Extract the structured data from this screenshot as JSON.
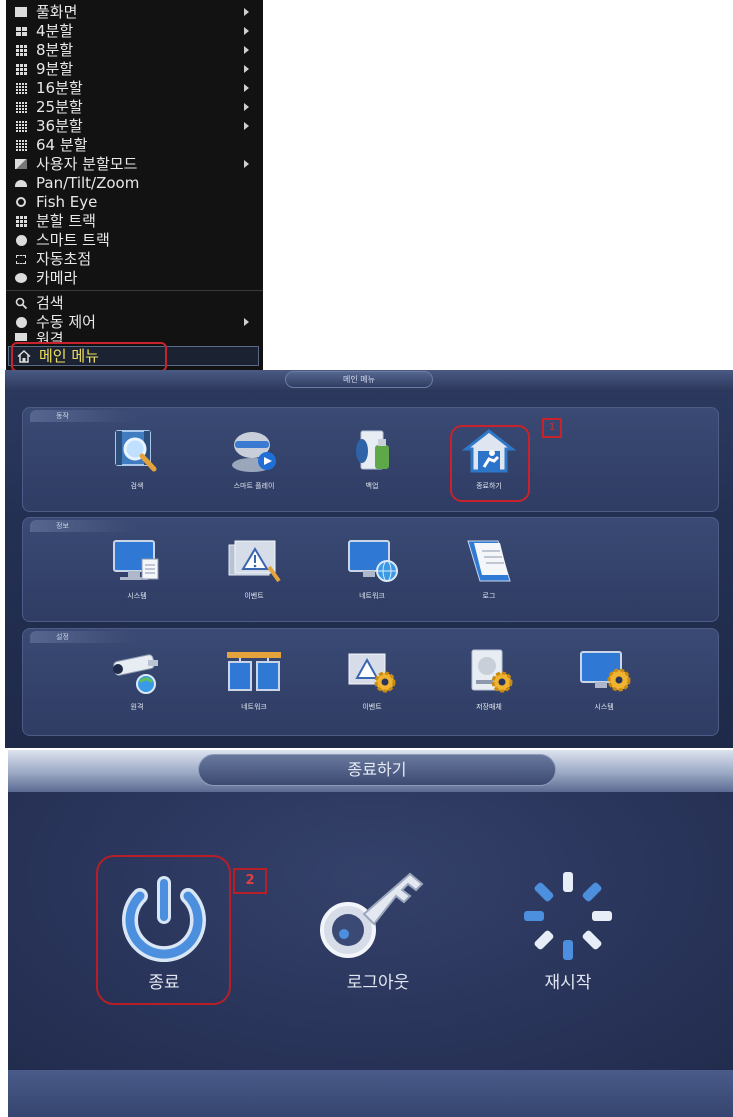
{
  "context_menu": {
    "items": [
      {
        "label": "풀화면",
        "icon": "square-icon",
        "has_submenu": true
      },
      {
        "label": "4분할",
        "icon": "grid-4-icon",
        "has_submenu": true
      },
      {
        "label": "8분할",
        "icon": "grid-8-icon",
        "has_submenu": true
      },
      {
        "label": "9분할",
        "icon": "grid-9-icon",
        "has_submenu": true
      },
      {
        "label": "16분할",
        "icon": "grid-16-icon",
        "has_submenu": true
      },
      {
        "label": "25분할",
        "icon": "grid-25-icon",
        "has_submenu": true
      },
      {
        "label": "36분할",
        "icon": "grid-36-icon",
        "has_submenu": true
      },
      {
        "label": "64 분할",
        "icon": "grid-64-icon",
        "has_submenu": false
      },
      {
        "label": "사용자 분할모드",
        "icon": "custom-split-icon",
        "has_submenu": true
      },
      {
        "label": "Pan/Tilt/Zoom",
        "icon": "ptz-camera-icon",
        "has_submenu": false
      },
      {
        "label": "Fish Eye",
        "icon": "fisheye-icon",
        "has_submenu": false
      },
      {
        "label": "분할 트랙",
        "icon": "split-track-icon",
        "has_submenu": false
      },
      {
        "label": "스마트 트랙",
        "icon": "smart-track-icon",
        "has_submenu": false
      },
      {
        "label": "자동초점",
        "icon": "autofocus-icon",
        "has_submenu": false
      },
      {
        "label": "카메라",
        "icon": "camera-icon",
        "has_submenu": false
      },
      {
        "label": "검색",
        "icon": "search-icon",
        "has_submenu": false
      },
      {
        "label": "수동 제어",
        "icon": "manual-control-icon",
        "has_submenu": true
      },
      {
        "label": "원격",
        "icon": "remote-icon",
        "has_submenu": false
      },
      {
        "label": "메인 메뉴",
        "icon": "home-icon",
        "has_submenu": false,
        "selected": true
      }
    ],
    "colors": {
      "background": "#121212",
      "text": "#e8e8e8",
      "selected_text": "#f0df5e",
      "highlight": "#c8232c"
    }
  },
  "main_menu": {
    "title": "메인 메뉴",
    "badge": "1",
    "sections": [
      {
        "label": "동작",
        "tiles": [
          {
            "label": "검색",
            "icon": "video-search-icon"
          },
          {
            "label": "스마트 플레이",
            "icon": "smart-play-icon"
          },
          {
            "label": "백업",
            "icon": "backup-usb-icon"
          },
          {
            "label": "종료하기",
            "icon": "exit-house-icon",
            "highlighted": true
          }
        ]
      },
      {
        "label": "정보",
        "tiles": [
          {
            "label": "시스템",
            "icon": "monitor-doc-icon"
          },
          {
            "label": "이벤트",
            "icon": "event-warning-icon"
          },
          {
            "label": "네트워크",
            "icon": "network-globe-icon"
          },
          {
            "label": "로그",
            "icon": "log-book-icon"
          }
        ]
      },
      {
        "label": "설정",
        "tiles": [
          {
            "label": "원격",
            "icon": "cctv-camera-icon"
          },
          {
            "label": "네트워크",
            "icon": "network-monitors-icon"
          },
          {
            "label": "이벤트",
            "icon": "event-gear-icon"
          },
          {
            "label": "저장매체",
            "icon": "storage-gear-icon"
          },
          {
            "label": "시스템",
            "icon": "system-gear-icon"
          }
        ]
      }
    ],
    "colors": {
      "background": "#243052",
      "section": "#34436c",
      "text": "#e4e8f2"
    }
  },
  "shutdown_dialog": {
    "title": "종료하기",
    "badge": "2",
    "options": [
      {
        "label": "종료",
        "icon": "power-icon",
        "highlighted": true
      },
      {
        "label": "로그아웃",
        "icon": "key-icon"
      },
      {
        "label": "재시작",
        "icon": "restart-spinner-icon"
      }
    ],
    "colors": {
      "background": "#27324f",
      "text": "#e3e7f1",
      "highlight": "#b81e26"
    }
  }
}
